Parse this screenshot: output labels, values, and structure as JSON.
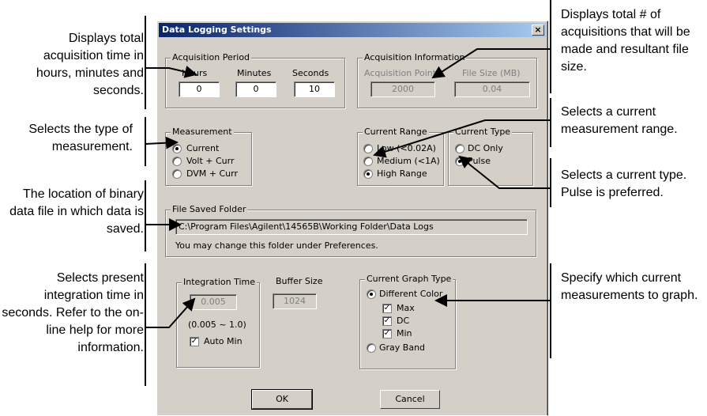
{
  "dialog": {
    "title": "Data Logging Settings",
    "close_glyph": "×",
    "acquisition_period": {
      "label": "Acquisition Period",
      "hours_label": "Hours",
      "minutes_label": "Minutes",
      "seconds_label": "Seconds",
      "hours": "0",
      "minutes": "0",
      "seconds": "10"
    },
    "acquisition_info": {
      "label": "Acquisition Information",
      "points_label": "Acquisition Points",
      "size_label": "File Size (MB)",
      "points": "2000",
      "size": "0.04"
    },
    "measurement": {
      "label": "Measurement",
      "options": [
        "Current",
        "Volt + Curr",
        "DVM + Curr"
      ],
      "selected": "Current"
    },
    "current_range": {
      "label": "Current Range",
      "options": [
        "Low (<0.02A)",
        "Medium (<1A)",
        "High Range"
      ],
      "selected": "High Range"
    },
    "current_type": {
      "label": "Current Type",
      "options": [
        "DC Only",
        "Pulse"
      ],
      "selected": "Pulse"
    },
    "file_saved": {
      "label": "File Saved Folder",
      "path": "C:\\Program Files\\Agilent\\14565B\\Working Folder\\Data Logs",
      "note": "You may change this folder under Preferences."
    },
    "integration": {
      "label": "Integration Time",
      "value": "0.005",
      "range": "(0.005 ~ 1.0)",
      "auto_min_label": "Auto Min",
      "auto_min": true
    },
    "buffer": {
      "label": "Buffer Size",
      "value": "1024"
    },
    "graph_type": {
      "label": "Current Graph Type",
      "different_color": "Different Color",
      "max": "Max",
      "dc": "DC",
      "min": "Min",
      "gray_band": "Gray Band",
      "selected": "Different Color"
    },
    "ok_label": "OK",
    "cancel_label": "Cancel",
    "check_glyph": "✓"
  },
  "callouts": {
    "left": [
      "Displays total acquisition time in hours, minutes and seconds.",
      "Selects the type of measurement.",
      "The location of binary data file in which data is saved.",
      "Selects present integration time in seconds. Refer to the on-line help for more information."
    ],
    "right": [
      "Displays total # of acquisitions that will be made and resultant file size.",
      "Selects a current measurement range.",
      "Selects a current type. Pulse is preferred.",
      "Specify which current measurements to graph."
    ]
  }
}
